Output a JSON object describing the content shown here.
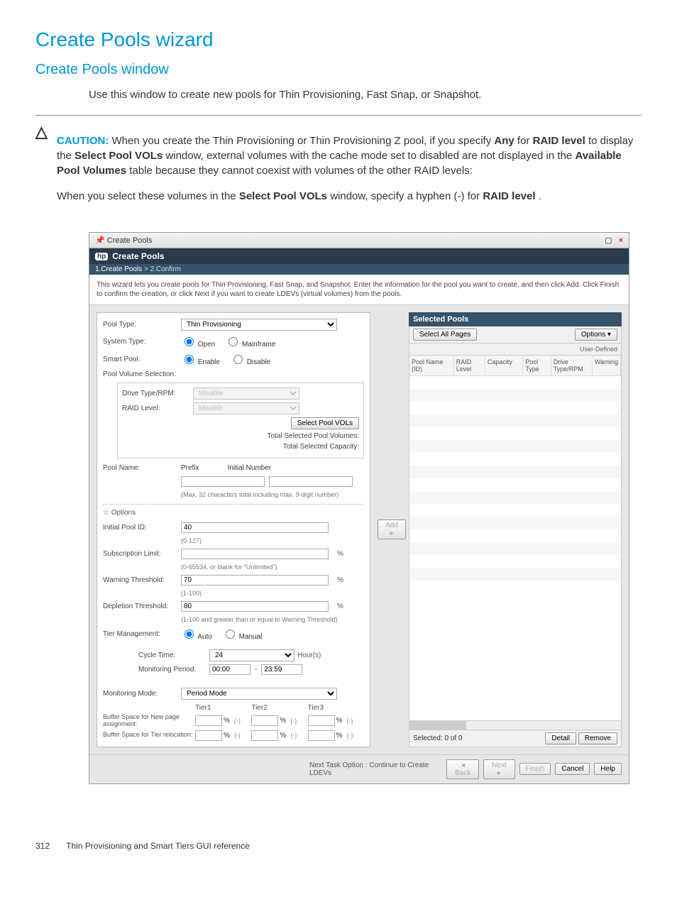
{
  "page": {
    "title": "Create Pools wizard",
    "subtitle": "Create Pools window",
    "intro": "Use this window to create new pools for Thin Provisioning, Fast Snap, or Snapshot.",
    "caution_label": "CAUTION:",
    "caution_p1_a": "When you create the Thin Provisioning or Thin Provisioning Z pool, if you specify ",
    "caution_p1_b": "Any",
    "caution_p1_c": " for ",
    "caution_p1_d": "RAID level",
    "caution_p1_e": " to display the ",
    "caution_p1_f": "Select Pool VOLs",
    "caution_p1_g": " window, external volumes with the cache mode set to disabled are not displayed in the ",
    "caution_p1_h": "Available Pool Volumes",
    "caution_p1_i": " table because they cannot coexist with volumes of the other RAID levels:",
    "caution_p2_a": "When you select these volumes in the ",
    "caution_p2_b": "Select Pool VOLs",
    "caution_p2_c": " window, specify a hyphen (-) for ",
    "caution_p2_d": "RAID level",
    "caution_p2_e": "."
  },
  "window": {
    "outer_title": "Create Pools",
    "inner_title": "Create Pools",
    "step1": "1.Create Pools",
    "step_sep": ">",
    "step2": "2.Confirm",
    "description": "This wizard lets you create pools for Thin Provisioning, Fast Snap, and Snapshot. Enter the information for the pool you want to create, and then click Add. Click Finish to confirm the creation, or click Next if you want to create LDEVs (virtual volumes) from the pools."
  },
  "form": {
    "pool_type_label": "Pool Type:",
    "pool_type_value": "Thin Provisioning",
    "system_type_label": "System Type:",
    "system_open": "Open",
    "system_mainframe": "Mainframe",
    "smart_pool_label": "Smart Pool:",
    "enable": "Enable",
    "disable": "Disable",
    "pvs_label": "Pool Volume Selection:",
    "drive_type_label": "Drive Type/RPM:",
    "raid_level_label": "RAID Level:",
    "mixable": "Mixable",
    "select_pool_vols_btn": "Select Pool VOLs",
    "total_vols": "Total Selected Pool Volumes:",
    "total_cap": "Total Selected Capacity:",
    "pool_name_label": "Pool Name:",
    "prefix": "Prefix",
    "initial_number": "Initial Number",
    "name_hint": "(Max. 32 characters total including max. 9-digit number)",
    "options_label": "Options",
    "initial_pool_id_label": "Initial Pool ID:",
    "initial_pool_id_value": "40",
    "initial_pool_id_hint": "(0-127)",
    "sub_limit_label": "Subscription Limit:",
    "sub_limit_value": "",
    "sub_limit_hint": "(0-65534, or blank for \"Unlimited\")",
    "warn_thresh_label": "Warning Threshold:",
    "warn_thresh_value": "70",
    "warn_thresh_hint": "(1-100)",
    "dep_thresh_label": "Depletion Threshold:",
    "dep_thresh_value": "80",
    "dep_thresh_hint": "(1-100 and greater than or equal to Warning Threshold)",
    "tier_mgmt_label": "Tier Management:",
    "auto": "Auto",
    "manual": "Manual",
    "cycle_time_label": "Cycle Time:",
    "cycle_time_value": "24",
    "cycle_time_unit": "Hour(s)",
    "mon_period_label": "Monitoring Period:",
    "mon_from": "00:00",
    "mon_to": "23:59",
    "mon_sep": "-",
    "mon_mode_label": "Monitoring Mode:",
    "mon_mode_value": "Period Mode",
    "tier1": "Tier1",
    "tier2": "Tier2",
    "tier3": "Tier3",
    "buf_new_label": "Buffer Space for New page assignment:",
    "buf_reloc_label": "Buffer Space for Tier relocation:",
    "dash_hint": "(-)",
    "pct": "%",
    "add_btn": "Add ▸"
  },
  "selected": {
    "header": "Selected Pools",
    "select_all": "Select All Pages",
    "options": "Options ▾",
    "filter": "User-Defined",
    "col1": "Pool Name (ID)",
    "col2": "RAID Level",
    "col3": "Capacity",
    "col4": "Pool Type",
    "col5": "Drive Type/RPM",
    "col6": "Warning",
    "status": "Selected:  0   of  0",
    "detail": "Detail",
    "remove": "Remove"
  },
  "footer": {
    "task": "Next Task Option : Continue to Create LDEVs",
    "back": "◂ Back",
    "next": "Next ▸",
    "finish": "Finish",
    "cancel": "Cancel",
    "help": "Help"
  },
  "pagefoot": {
    "num": "312",
    "text": "Thin Provisioning and Smart Tiers GUI reference"
  }
}
